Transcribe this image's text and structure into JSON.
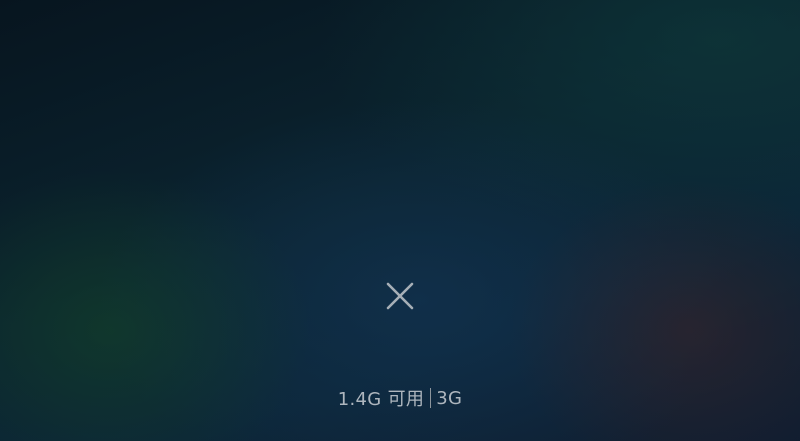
{
  "recents": {
    "clear_all": {
      "icon": "close-icon",
      "color": "#a7afb7"
    },
    "memory": {
      "available": "1.4G 可用",
      "total": "3G",
      "text_color": "#aeb6be"
    }
  },
  "background": {
    "base_colors": [
      "#07151f",
      "#0b2430",
      "#0c2638",
      "#101d30"
    ]
  }
}
